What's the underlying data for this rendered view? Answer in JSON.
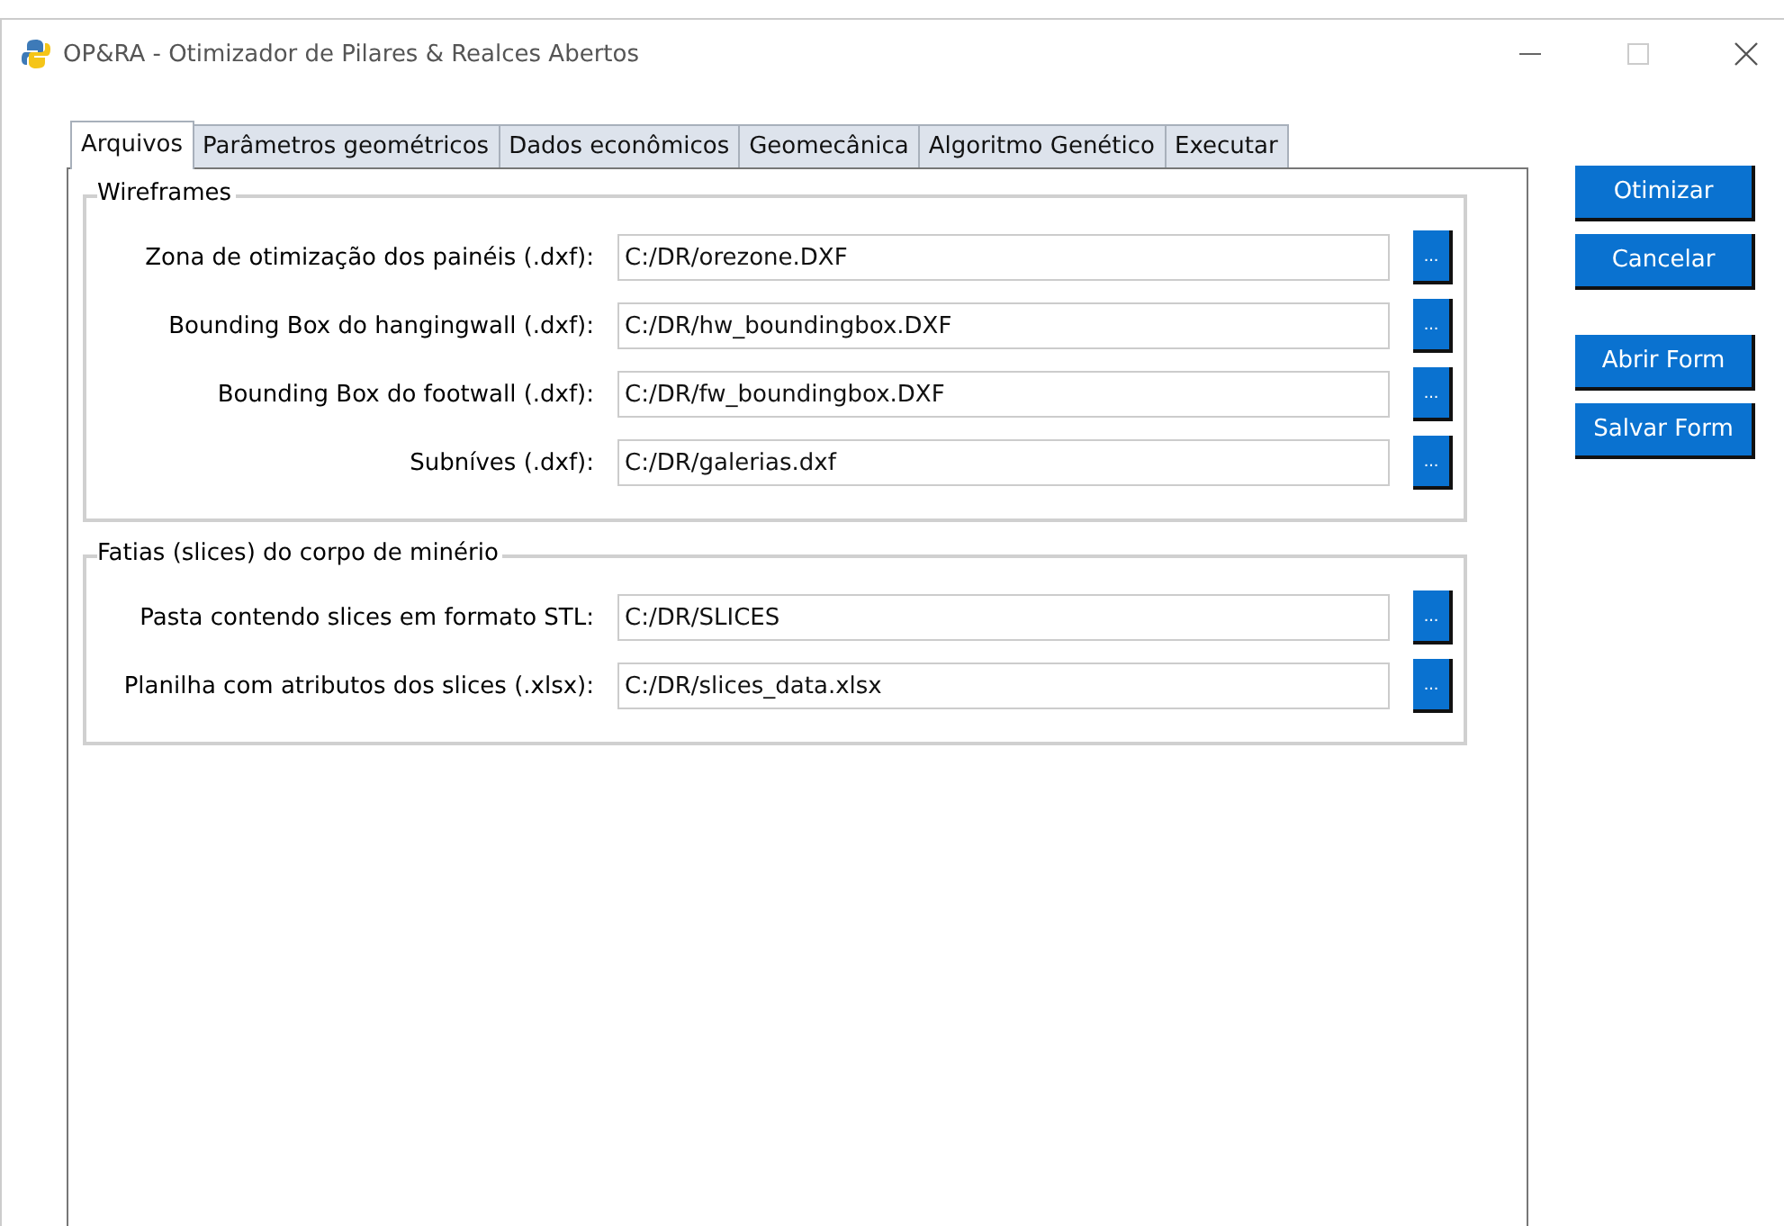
{
  "window": {
    "title": "OP&RA - Otimizador de Pilares & Realces Abertos"
  },
  "tabs": [
    {
      "label": "Arquivos",
      "selected": true
    },
    {
      "label": "Parâmetros geométricos",
      "selected": false
    },
    {
      "label": "Dados econômicos",
      "selected": false
    },
    {
      "label": "Geomecânica",
      "selected": false
    },
    {
      "label": "Algoritmo Genético",
      "selected": false
    },
    {
      "label": "Executar",
      "selected": false
    }
  ],
  "groups": [
    {
      "title": "Wireframes",
      "fields": [
        {
          "label": "Zona de otimização dos painéis (.dxf):",
          "value": "C:/DR/orezone.DXF",
          "button": "..."
        },
        {
          "label": "Bounding Box do hangingwall (.dxf):",
          "value": "C:/DR/hw_boundingbox.DXF",
          "button": "..."
        },
        {
          "label": "Bounding Box do footwall (.dxf):",
          "value": "C:/DR/fw_boundingbox.DXF",
          "button": "..."
        },
        {
          "label": "Subníves (.dxf):",
          "value": "C:/DR/galerias.dxf",
          "button": "..."
        }
      ]
    },
    {
      "title": "Fatias (slices) do corpo de minério",
      "fields": [
        {
          "label": "Pasta contendo slices em formato STL:",
          "value": "C:/DR/SLICES",
          "button": "..."
        },
        {
          "label": "Planilha com atributos dos slices (.xlsx):",
          "value": "C:/DR/slices_data.xlsx",
          "button": "..."
        }
      ]
    }
  ],
  "actions": [
    [
      "Otimizar",
      "Cancelar"
    ],
    [
      "Abrir Form",
      "Salvar Form"
    ]
  ]
}
